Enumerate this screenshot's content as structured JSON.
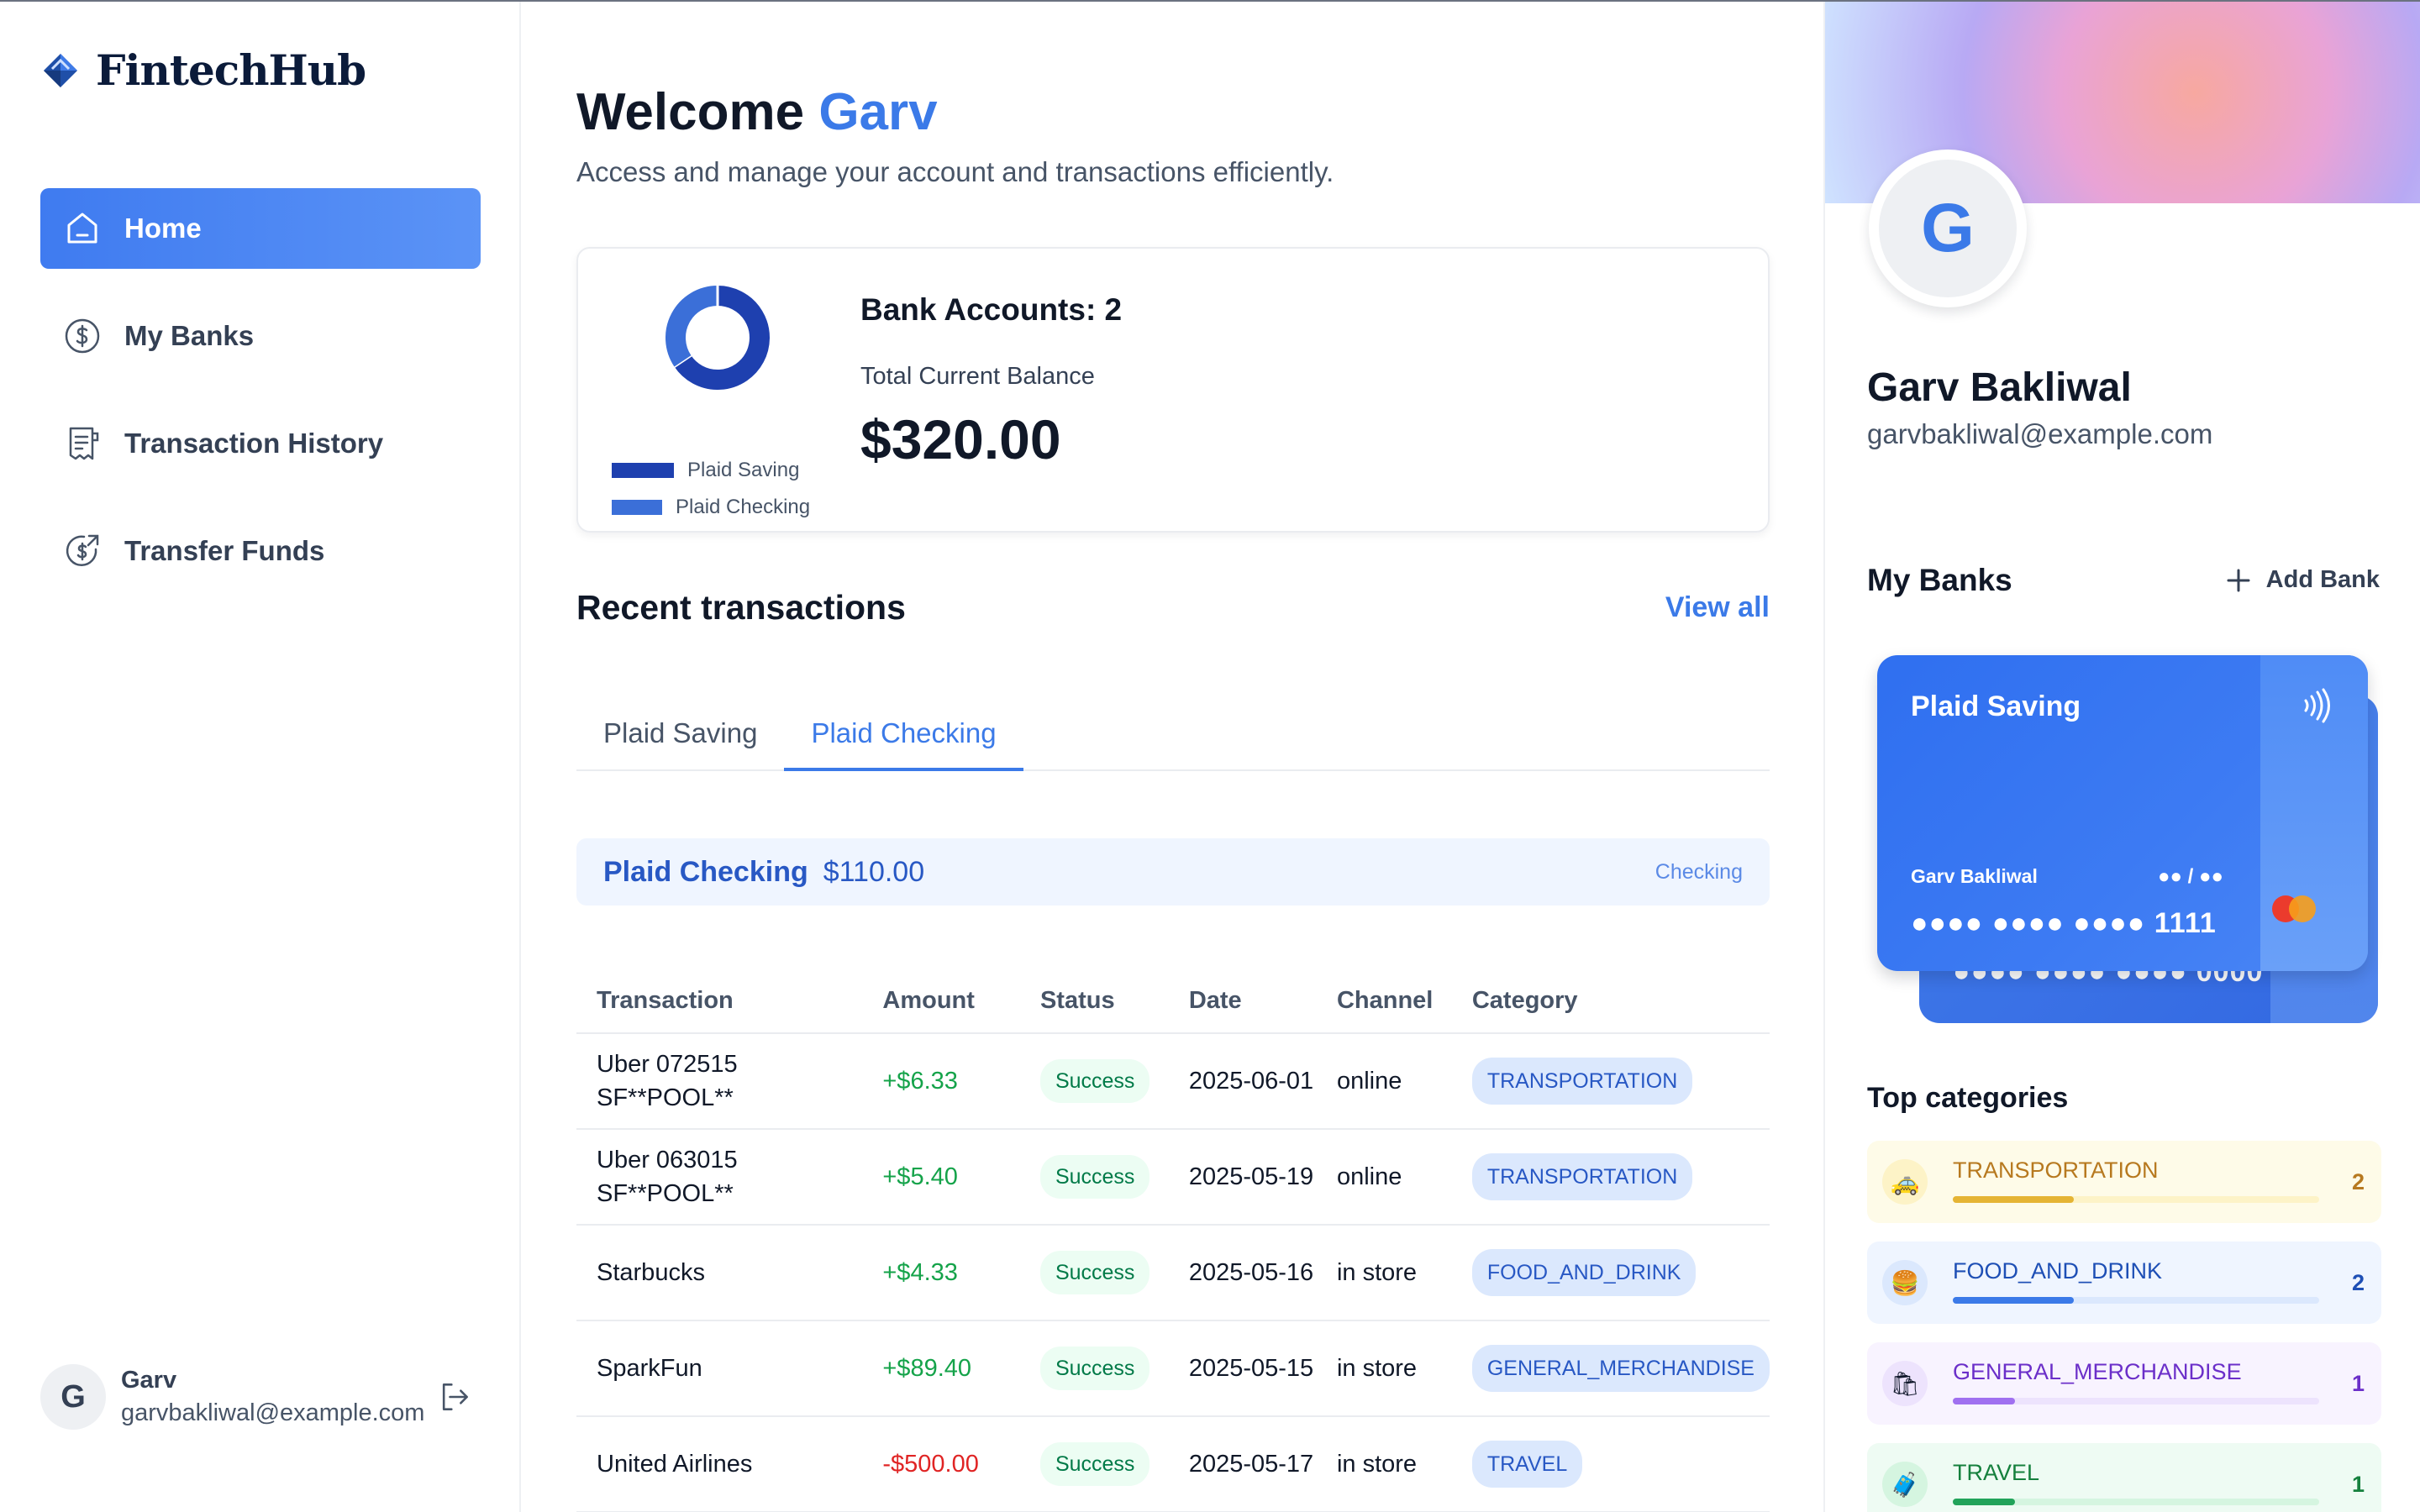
{
  "brand": {
    "name": "FintechHub"
  },
  "sidebar": {
    "items": [
      {
        "label": "Home",
        "icon": "home-icon",
        "active": true
      },
      {
        "label": "My Banks",
        "icon": "dollar-circle-icon",
        "active": false
      },
      {
        "label": "Transaction History",
        "icon": "receipt-icon",
        "active": false
      },
      {
        "label": "Transfer Funds",
        "icon": "transfer-icon",
        "active": false
      }
    ],
    "footer": {
      "initial": "G",
      "name": "Garv",
      "email": "garvbakliwal@example.com"
    }
  },
  "header": {
    "welcome": "Welcome",
    "user": "Garv",
    "subtitle": "Access and manage your account and transactions efficiently."
  },
  "balance": {
    "bank_accounts_label": "Bank Accounts: 2",
    "total_label": "Total Current Balance",
    "total_value": "$320.00",
    "legend": [
      {
        "name": "Plaid Saving",
        "color": "#1e40af"
      },
      {
        "name": "Plaid Checking",
        "color": "#3b6fd8"
      }
    ],
    "donut_shares": [
      0.656,
      0.344
    ]
  },
  "recent": {
    "title": "Recent transactions",
    "view_all": "View all",
    "tabs": [
      {
        "label": "Plaid Saving",
        "active": false
      },
      {
        "label": "Plaid Checking",
        "active": true
      }
    ],
    "banner": {
      "name": "Plaid Checking",
      "balance": "$110.00",
      "type": "Checking"
    },
    "columns": [
      "Transaction",
      "Amount",
      "Status",
      "Date",
      "Channel",
      "Category"
    ],
    "rows": [
      {
        "name": "Uber 072515 SF**POOL**",
        "amount": "+$6.33",
        "positive": true,
        "status": "Success",
        "date": "2025-06-01",
        "channel": "online",
        "category": "TRANSPORTATION"
      },
      {
        "name": "Uber 063015 SF**POOL**",
        "amount": "+$5.40",
        "positive": true,
        "status": "Success",
        "date": "2025-05-19",
        "channel": "online",
        "category": "TRANSPORTATION"
      },
      {
        "name": "Starbucks",
        "amount": "+$4.33",
        "positive": true,
        "status": "Success",
        "date": "2025-05-16",
        "channel": "in store",
        "category": "FOOD_AND_DRINK"
      },
      {
        "name": "SparkFun",
        "amount": "+$89.40",
        "positive": true,
        "status": "Success",
        "date": "2025-05-15",
        "channel": "in store",
        "category": "GENERAL_MERCHANDISE"
      },
      {
        "name": "United Airlines",
        "amount": "-$500.00",
        "positive": false,
        "status": "Success",
        "date": "2025-05-17",
        "channel": "in store",
        "category": "TRAVEL"
      }
    ]
  },
  "profile": {
    "initial": "G",
    "name": "Garv Bakliwal",
    "email": "garvbakliwal@example.com"
  },
  "banks": {
    "title": "My Banks",
    "add_label": "Add Bank",
    "front_card": {
      "name": "Plaid Saving",
      "owner": "Garv Bakliwal",
      "expiry": "●● / ●●",
      "number": "●●●● ●●●● ●●●● 1111"
    },
    "back_card": {
      "number": "●●●● ●●●● ●●●● 0000"
    }
  },
  "top_categories": {
    "title": "Top categories",
    "items": [
      {
        "name": "TRANSPORTATION",
        "count": "2",
        "fill": 0.33,
        "bg": "#fefbe8",
        "bar": "#fdf3c7",
        "fillColor": "#e5b434",
        "text": "#b7791f",
        "icon": "🚕"
      },
      {
        "name": "FOOD_AND_DRINK",
        "count": "2",
        "fill": 0.33,
        "bg": "#eff5ff",
        "bar": "#dbe8fd",
        "fillColor": "#3b7ae8",
        "text": "#1e4fb5",
        "icon": "🍔"
      },
      {
        "name": "GENERAL_MERCHANDISE",
        "count": "1",
        "fill": 0.17,
        "bg": "#f8f3ff",
        "bar": "#ede3fd",
        "fillColor": "#a070f0",
        "text": "#6b2fc9",
        "icon": "🛍"
      },
      {
        "name": "TRAVEL",
        "count": "1",
        "fill": 0.17,
        "bg": "#eefbf3",
        "bar": "#d5f5e0",
        "fillColor": "#22a35a",
        "text": "#15803d",
        "icon": "🧳"
      }
    ]
  }
}
